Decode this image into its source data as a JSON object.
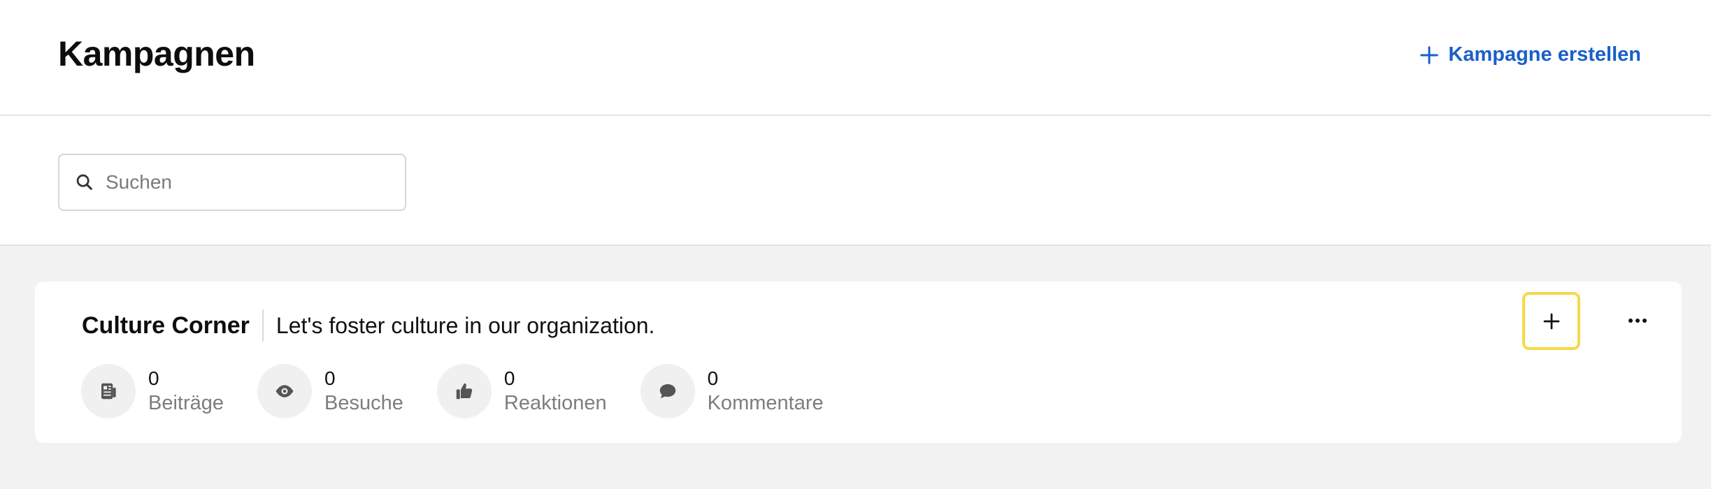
{
  "header": {
    "title": "Kampagnen",
    "create_label": "Kampagne erstellen"
  },
  "search": {
    "placeholder": "Suchen",
    "value": ""
  },
  "campaign": {
    "title": "Culture Corner",
    "description": "Let's foster culture in our organization.",
    "stats": [
      {
        "icon": "posts-icon",
        "value": "0",
        "label": "Beiträge"
      },
      {
        "icon": "eye-icon",
        "value": "0",
        "label": "Besuche"
      },
      {
        "icon": "thumbs-up-icon",
        "value": "0",
        "label": "Reaktionen"
      },
      {
        "icon": "comment-icon",
        "value": "0",
        "label": "Kommentare"
      }
    ]
  },
  "colors": {
    "accent": "#1a5fc9",
    "focus_outline": "#f5d94a",
    "background_gray": "#f2f2f2"
  }
}
